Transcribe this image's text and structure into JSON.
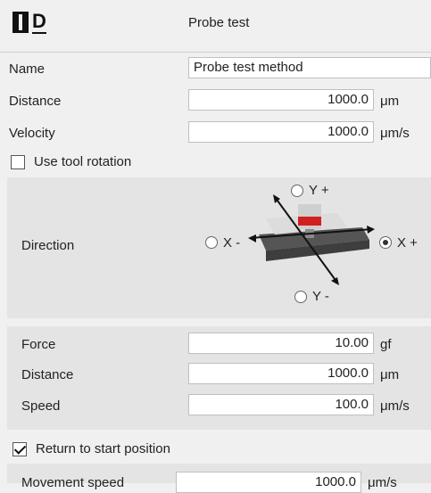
{
  "header": {
    "logo_text": "D",
    "title": "Probe test"
  },
  "name": {
    "label": "Name",
    "value": "Probe test method"
  },
  "distance": {
    "label": "Distance",
    "value": "1000.0",
    "unit": "μm"
  },
  "velocity": {
    "label": "Velocity",
    "value": "1000.0",
    "unit": "μm/s"
  },
  "use_tool_rotation": {
    "label": "Use tool rotation",
    "checked": false
  },
  "direction": {
    "label": "Direction",
    "y_plus": "Y +",
    "y_minus": "Y -",
    "x_minus": "X -",
    "x_plus": "X +",
    "selected": "X +"
  },
  "force": {
    "label": "Force",
    "value": "10.00",
    "unit": "gf"
  },
  "test_distance": {
    "label": "Distance",
    "value": "1000.0",
    "unit": "μm"
  },
  "speed": {
    "label": "Speed",
    "value": "100.0",
    "unit": "μm/s"
  },
  "return_to_start": {
    "label": "Return to start position",
    "checked": true
  },
  "movement_speed": {
    "label": "Movement speed",
    "value": "1000.0",
    "unit": "μm/s"
  }
}
